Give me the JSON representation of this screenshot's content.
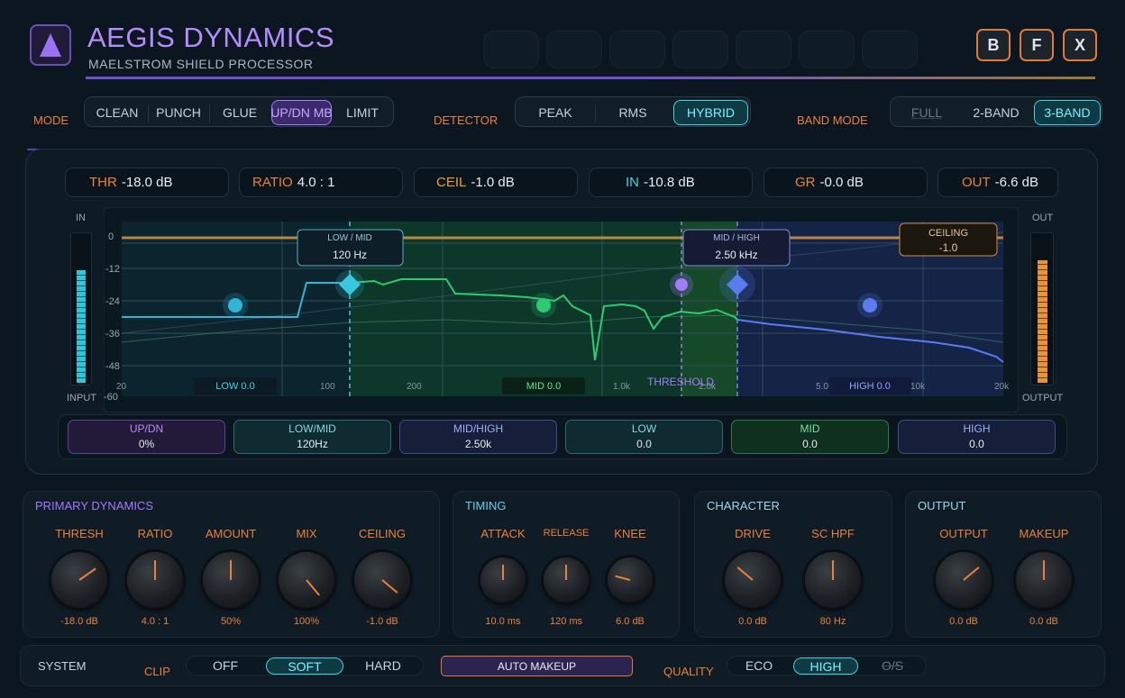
{
  "header": {
    "title": "AEGIS DYNAMICS",
    "subtitle": "MAELSTROM SHIELD PROCESSOR",
    "buttons": [
      "B",
      "F",
      "X"
    ]
  },
  "mode": {
    "label": "MODE",
    "options": [
      "CLEAN",
      "PUNCH",
      "GLUE",
      "UP/DN MB",
      "LIMIT"
    ],
    "selected": "UP/DN MB"
  },
  "detector": {
    "label": "DETECTOR",
    "options": [
      "PEAK",
      "RMS",
      "HYBRID"
    ],
    "selected": "HYBRID"
  },
  "band_mode": {
    "label": "BAND MODE",
    "options": [
      "FULL",
      "2-BAND",
      "3-BAND"
    ],
    "selected": "3-BAND"
  },
  "readouts": [
    {
      "key": "THR",
      "value": "-18.0 dB",
      "color": "#e8823a"
    },
    {
      "key": "RATIO",
      "value": "4.0 : 1",
      "color": "#e8823a"
    },
    {
      "key": "CEIL",
      "value": "-1.0 dB",
      "color": "#e8a23a"
    },
    {
      "key": "IN",
      "value": "-10.8 dB",
      "color": "#3fd3e6"
    },
    {
      "key": "GR",
      "value": "-0.0 dB",
      "color": "#e8823a"
    },
    {
      "key": "OUT",
      "value": "-6.6 dB",
      "color": "#e8823a"
    }
  ],
  "meters": {
    "input_label_top": "IN",
    "input_label_bottom": "INPUT",
    "output_label_top": "OUT",
    "output_label_bottom": "OUTPUT",
    "input_level": 0.75,
    "output_level": 0.82
  },
  "graph": {
    "y_ticks": [
      "0",
      "-12",
      "-24",
      "-36",
      "-48",
      "-60"
    ],
    "x_ticks": [
      "20",
      "100",
      "200",
      "1.0k",
      "2.0k",
      "5.0k",
      "10k",
      "20k"
    ],
    "crossover_low_mid": {
      "title": "LOW / MID",
      "value": "120 Hz"
    },
    "crossover_mid_high": {
      "title": "MID / HIGH",
      "value": "2.50 kHz"
    },
    "ceiling_box": {
      "title": "CEILING",
      "value": "-1.0"
    },
    "threshold_label": "THRESHOLD",
    "band_labels": {
      "low": "LOW 0.0",
      "mid": "MID 0.0",
      "high": "HIGH 0.0"
    }
  },
  "band_params": [
    {
      "title": "UP/DN",
      "value": "0%"
    },
    {
      "title": "LOW/MID",
      "value": "120Hz"
    },
    {
      "title": "MID/HIGH",
      "value": "2.50k"
    },
    {
      "title": "LOW",
      "value": "0.0"
    },
    {
      "title": "MID",
      "value": "0.0"
    },
    {
      "title": "HIGH",
      "value": "0.0"
    }
  ],
  "primary_dynamics": {
    "title": "PRIMARY DYNAMICS",
    "knobs": [
      {
        "label": "THRESH",
        "value": "-18.0 dB"
      },
      {
        "label": "RATIO",
        "value": "4.0 : 1"
      },
      {
        "label": "AMOUNT",
        "value": "50%"
      },
      {
        "label": "MIX",
        "value": "100%"
      },
      {
        "label": "CEILING",
        "value": "-1.0 dB"
      }
    ]
  },
  "timing": {
    "title": "TIMING",
    "knobs": [
      {
        "label": "ATTACK",
        "value": "10.0 ms"
      },
      {
        "label": "RELEASE",
        "value": "120 ms"
      },
      {
        "label": "KNEE",
        "value": "6.0 dB"
      }
    ]
  },
  "character": {
    "title": "CHARACTER",
    "knobs": [
      {
        "label": "DRIVE",
        "value": "0.0 dB"
      },
      {
        "label": "SC HPF",
        "value": "80 Hz"
      }
    ]
  },
  "output": {
    "title": "OUTPUT",
    "knobs": [
      {
        "label": "OUTPUT",
        "value": "0.0 dB"
      },
      {
        "label": "MAKEUP",
        "value": "0.0 dB"
      }
    ]
  },
  "system": {
    "label": "SYSTEM",
    "clip_label": "CLIP",
    "clip_options": [
      "OFF",
      "SOFT",
      "HARD"
    ],
    "clip_selected": "SOFT",
    "auto_makeup": "AUTO MAKEUP",
    "quality_label": "QUALITY",
    "quality_options": [
      "ECO",
      "HIGH",
      "O/S"
    ],
    "quality_selected": "HIGH"
  },
  "colors": {
    "accent_purple": "#a27bff",
    "accent_cyan": "#3fd3e6",
    "accent_orange": "#e8823a",
    "low_band": "#2fb6d6",
    "mid_band": "#2ecc71",
    "high_band": "#5b7cf0"
  }
}
